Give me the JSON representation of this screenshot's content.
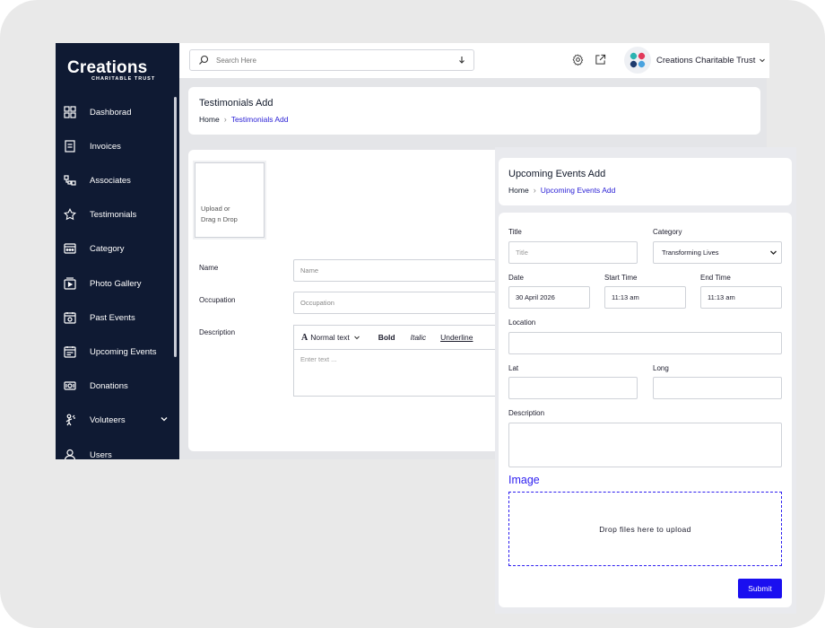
{
  "brand": {
    "logo_main": "Creations",
    "logo_sub": "CHARITABLE TRUST",
    "org_name": "Creations Charitable Trust"
  },
  "sidebar": {
    "items": [
      {
        "label": "Dashborad",
        "icon": "grid-icon"
      },
      {
        "label": "Invoices",
        "icon": "invoice-icon"
      },
      {
        "label": "Associates",
        "icon": "associates-icon"
      },
      {
        "label": "Testimonials",
        "icon": "star-icon"
      },
      {
        "label": "Category",
        "icon": "category-icon"
      },
      {
        "label": "Photo Gallery",
        "icon": "photo-gallery-icon"
      },
      {
        "label": "Past Events",
        "icon": "calendar-past-icon"
      },
      {
        "label": "Upcoming Events",
        "icon": "calendar-upcoming-icon"
      },
      {
        "label": "Donations",
        "icon": "money-icon"
      },
      {
        "label": "Voluteers",
        "icon": "volunteer-icon"
      },
      {
        "label": "Users",
        "icon": "user-icon"
      }
    ]
  },
  "search": {
    "placeholder": "Search Here"
  },
  "testimonials": {
    "title": "Testimonials Add",
    "breadcrumb_home": "Home",
    "breadcrumb_current": "Testimonials Add",
    "upload_text_1": "Upload or",
    "upload_text_2": "Drag n Drop",
    "name_label": "Name",
    "name_placeholder": "Name",
    "occupation_label": "Occupation",
    "occupation_placeholder": "Occupation",
    "description_label": "Description",
    "editor": {
      "format": "Normal text",
      "bold": "Bold",
      "italic": "Italic",
      "underline": "Underline",
      "placeholder": "Enter text ..."
    }
  },
  "upcoming": {
    "title": "Upcoming Events Add",
    "breadcrumb_home": "Home",
    "breadcrumb_current": "Upcoming Events Add",
    "title_label": "Title",
    "title_placeholder": "Title",
    "category_label": "Category",
    "category_value": "Transforming Lives",
    "date_label": "Date",
    "date_value": "30 April 2026",
    "start_time_label": "Start Time",
    "start_time_value": "11:13 am",
    "end_time_label": "End Time",
    "end_time_value": "11:13 am",
    "location_label": "Location",
    "lat_label": "Lat",
    "long_label": "Long",
    "description_label": "Description",
    "image_heading": "Image",
    "drop_text": "Drop files here to upload",
    "submit_label": "Submit"
  },
  "colors": {
    "sidebar_bg": "#0f1a33",
    "accent": "#1a0ff0",
    "breadcrumb_link": "#2d23d6"
  }
}
